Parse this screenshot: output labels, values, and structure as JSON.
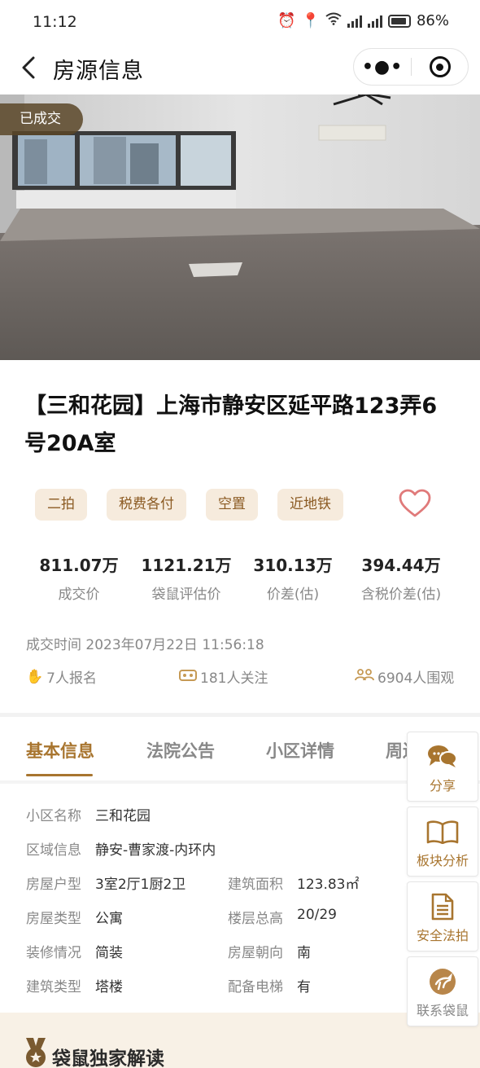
{
  "status_bar": {
    "time": "11:12",
    "battery": "86%"
  },
  "nav": {
    "title": "房源信息",
    "more_icon": "more-dots-icon",
    "close_icon": "target-close-icon"
  },
  "photo": {
    "badge": "已成交"
  },
  "listing": {
    "title": "【三和花园】上海市静安区延平路123弄6号20A室",
    "tags": [
      "二拍",
      "税费各付",
      "空置",
      "近地铁"
    ],
    "stats": [
      {
        "value": "811.07万",
        "label": "成交价"
      },
      {
        "value": "1121.21万",
        "label": "袋鼠评估价"
      },
      {
        "value": "310.13万",
        "label": "价差(估)"
      },
      {
        "value": "394.44万",
        "label": "含税价差(估)"
      }
    ],
    "deal_time_label": "成交时间",
    "deal_time": "2023年07月22日 11:56:18",
    "signups": "7人报名",
    "followers": "181人关注",
    "viewers": "6904人围观"
  },
  "tabs": [
    "基本信息",
    "法院公告",
    "小区详情",
    "周边"
  ],
  "basic_info": {
    "community_name_label": "小区名称",
    "community_name": "三和花园",
    "area_label": "区域信息",
    "area": "静安-曹家渡-内环内",
    "layout_label": "房屋户型",
    "layout": "3室2厅1厨2卫",
    "build_area_label": "建筑面积",
    "build_area": "123.83㎡",
    "house_type_label": "房屋类型",
    "house_type": "公寓",
    "floor_label": "楼层总高",
    "floor": "20/29",
    "decor_label": "装修情况",
    "decor": "简装",
    "orientation_label": "房屋朝向",
    "orientation": "南",
    "building_type_label": "建筑类型",
    "building_type": "塔楼",
    "elevator_label": "配备电梯",
    "elevator": "有"
  },
  "side_buttons": [
    "分享",
    "板块分析",
    "安全法拍",
    "联系袋鼠"
  ],
  "bottom": {
    "title": "袋鼠独家解读"
  },
  "colors": {
    "accent": "#a8752f",
    "tag_bg": "#f6ebdd",
    "heart": "#e07a7a"
  }
}
